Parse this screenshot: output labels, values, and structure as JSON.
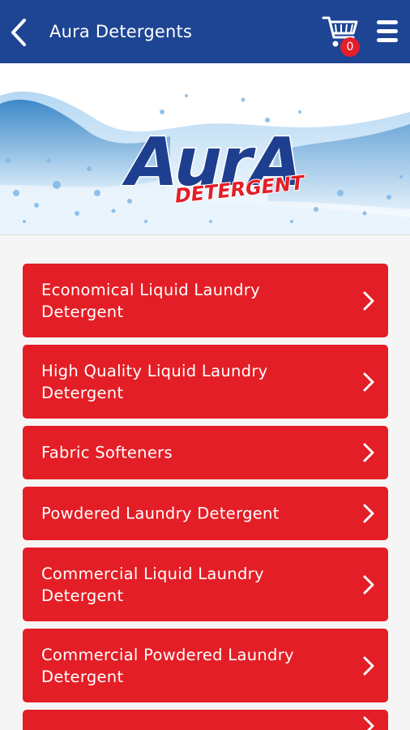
{
  "header": {
    "title": "Aura Detergents",
    "back_icon": "chevron-left-icon",
    "cart_icon": "cart-icon",
    "cart_count": "0",
    "menu_icon": "hamburger-menu-icon",
    "background_color": "#1e4494"
  },
  "banner": {
    "brand_logo": "AurA",
    "brand_sub": "DETERGENT",
    "brand_color": "#1e3f8f",
    "accent_color": "#e41e26"
  },
  "categories": [
    {
      "label": "Economical Liquid Laundry Detergent"
    },
    {
      "label": "High Quality Liquid Laundry Detergent"
    },
    {
      "label": "Fabric Softeners"
    },
    {
      "label": "Powdered Laundry Detergent"
    },
    {
      "label": "Commercial Liquid Laundry Detergent"
    },
    {
      "label": "Commercial Powdered Laundry Detergent"
    },
    {
      "label": ""
    }
  ],
  "colors": {
    "button": "#e41e26",
    "page_background": "#f5f5f5"
  }
}
